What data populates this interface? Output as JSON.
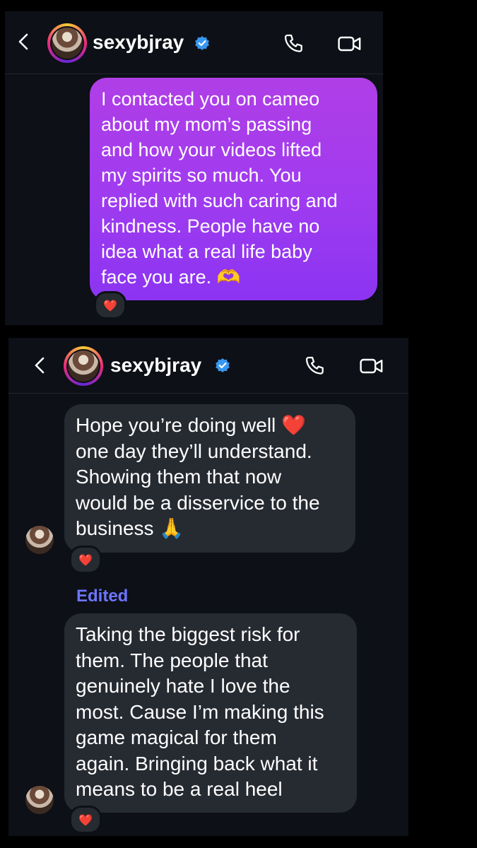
{
  "screens": [
    {
      "header": {
        "username": "sexybjray",
        "verified": true
      },
      "messages": [
        {
          "direction": "outgoing",
          "text": "I contacted you on cameo\nabout my mom’s passing\nand how your videos lifted\nmy spirits so much. You\nreplied with such caring and\nkindness. People have no\nidea what a real life baby\nface you are. 🫶",
          "reaction": "❤️"
        }
      ]
    },
    {
      "header": {
        "username": "sexybjray",
        "verified": true
      },
      "messages": [
        {
          "direction": "incoming",
          "text": "Hope you’re doing well ❤️\none day they’ll understand.\nShowing them that now\nwould be a disservice to the\nbusiness 🙏",
          "reaction": "❤️"
        },
        {
          "direction": "incoming",
          "edited_label": "Edited",
          "text": "Taking the biggest risk for\nthem. The people that\ngenuinely hate I love the\nmost. Cause I’m making this\ngame magical for them\nagain. Bringing back what it\nmeans to be a real heel",
          "reaction": "❤️"
        }
      ]
    }
  ],
  "colors": {
    "background": "#000000",
    "panel": "#0d1016",
    "incoming_bubble": "#262a31",
    "outgoing_gradient_top": "#b03ee6",
    "outgoing_gradient_bottom": "#8b34f2",
    "edited_label": "#6d75ff",
    "verified_badge": "#3897f0"
  },
  "icons": [
    "back-chevron-icon",
    "verified-badge-icon",
    "phone-icon",
    "video-camera-icon",
    "heart-reaction-icon"
  ]
}
